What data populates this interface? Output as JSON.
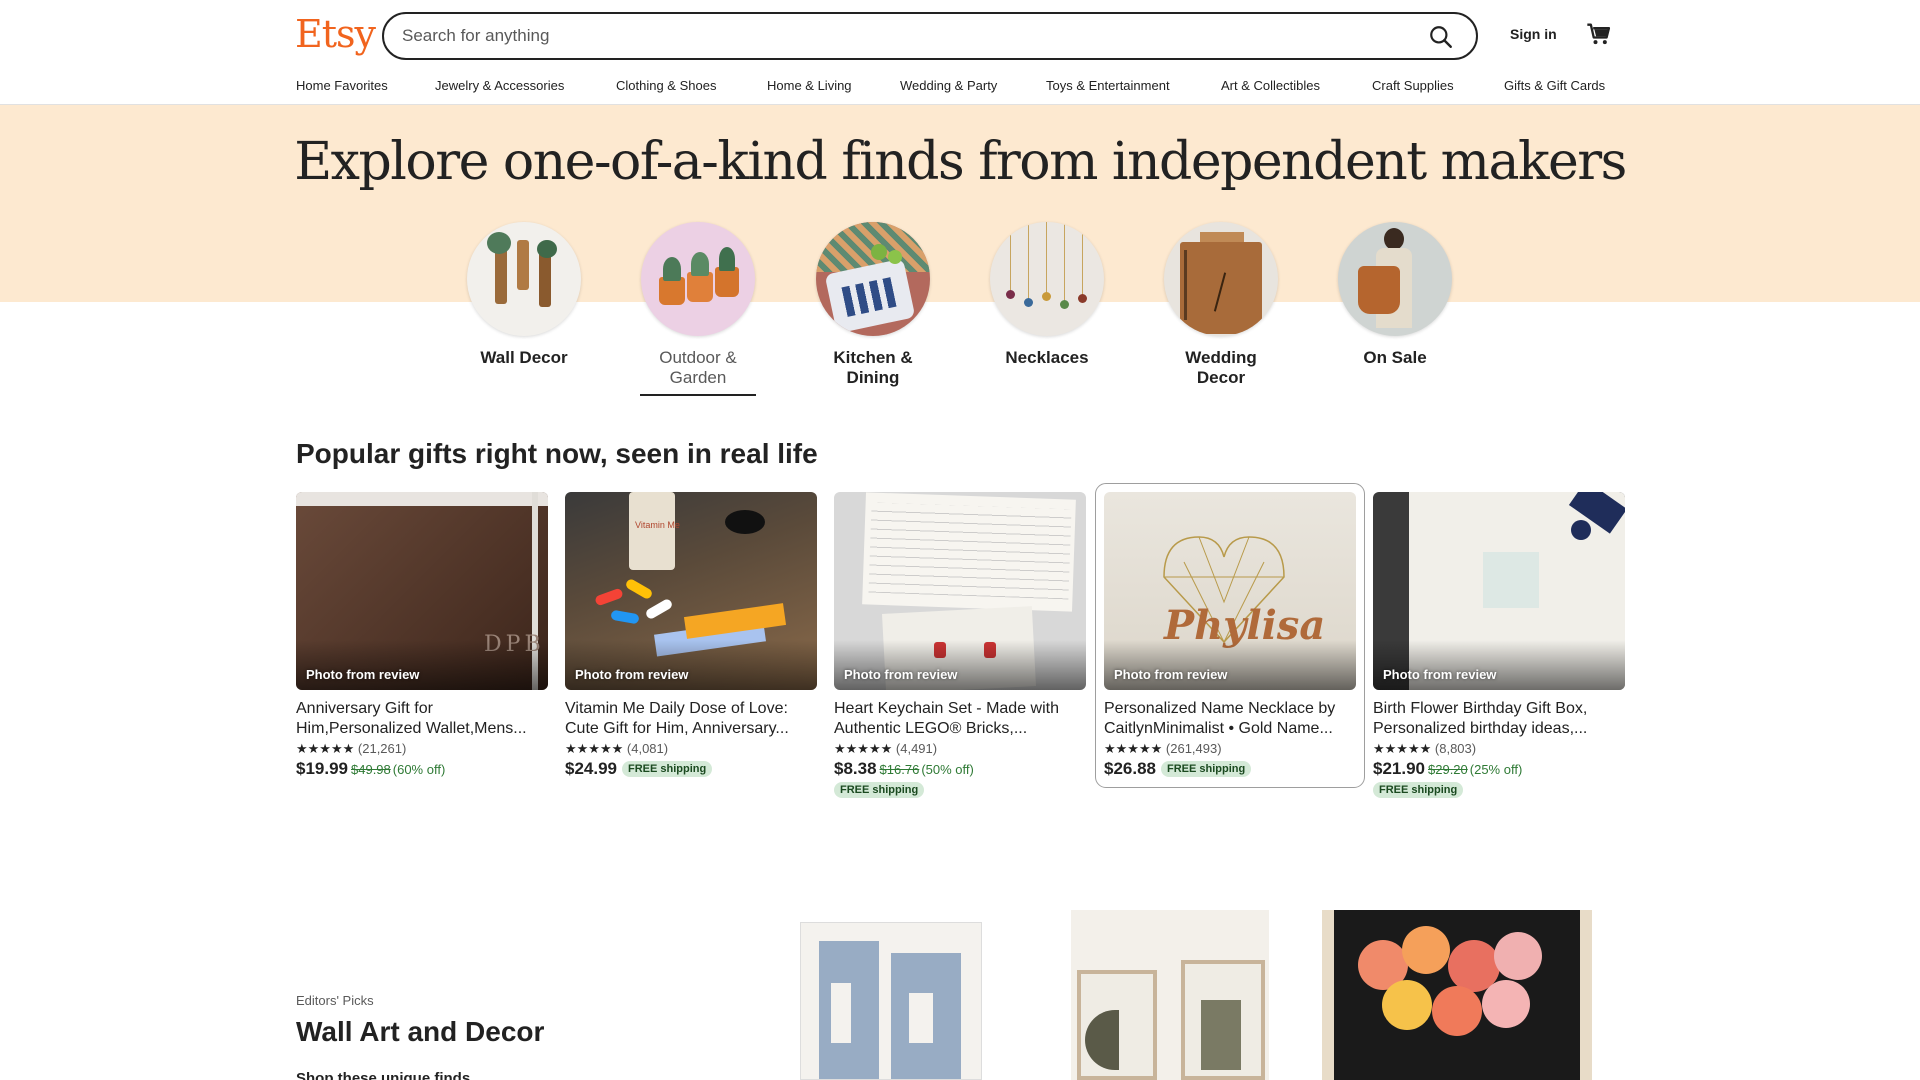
{
  "header": {
    "logo": "Etsy",
    "search_placeholder": "Search for anything",
    "signin": "Sign in"
  },
  "nav": [
    "Home Favorites",
    "Jewelry & Accessories",
    "Clothing & Shoes",
    "Home & Living",
    "Wedding & Party",
    "Toys & Entertainment",
    "Art & Collectibles",
    "Craft Supplies",
    "Gifts & Gift Cards"
  ],
  "hero": {
    "title": "Explore one-of-a-kind finds from independent makers",
    "categories": [
      {
        "label": "Wall Decor"
      },
      {
        "label": "Outdoor & Garden"
      },
      {
        "label": "Kitchen & Dining"
      },
      {
        "label": "Necklaces"
      },
      {
        "label": "Wedding Decor"
      },
      {
        "label": "On Sale"
      }
    ]
  },
  "popular": {
    "title": "Popular gifts right now, seen in real life",
    "badge": "Photo from review",
    "stars": "★★★★★",
    "free_shipping": "FREE shipping",
    "items": [
      {
        "title": "Anniversary Gift for Him,Personalized Wallet,Mens...",
        "reviews": "(21,261)",
        "price": "$19.99",
        "original": "$49.98",
        "discount": "(60% off)",
        "free": false
      },
      {
        "title": "Vitamin Me Daily Dose of Love: Cute Gift for Him, Anniversary...",
        "reviews": "(4,081)",
        "price": "$24.99",
        "original": "",
        "discount": "",
        "free": true
      },
      {
        "title": "Heart Keychain Set - Made with Authentic LEGO® Bricks,...",
        "reviews": "(4,491)",
        "price": "$8.38",
        "original": "$16.76",
        "discount": "(50% off)",
        "free": true
      },
      {
        "title": "Personalized Name Necklace by CaitlynMinimalist • Gold Name...",
        "reviews": "(261,493)",
        "price": "$26.88",
        "original": "",
        "discount": "",
        "free": true
      },
      {
        "title": "Birth Flower Birthday Gift Box, Personalized birthday ideas,...",
        "reviews": "(8,803)",
        "price": "$21.90",
        "original": "$29.20",
        "discount": "(25% off)",
        "free": true
      }
    ]
  },
  "editors": {
    "label": "Editors' Picks",
    "title": "Wall Art and Decor",
    "subtitle": "Shop these unique finds"
  },
  "colors": {
    "brand": "#f1641e",
    "hero_bg": "#fde9d0",
    "sale_green": "#2f7a35",
    "free_badge": "#d4e9d7"
  }
}
